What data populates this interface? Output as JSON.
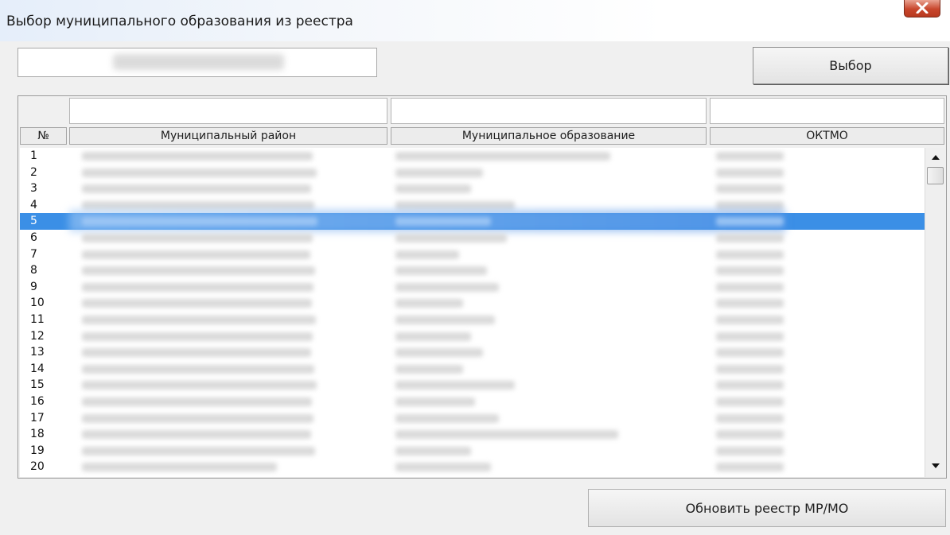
{
  "window": {
    "title": "Выбор муниципального образования из реестра",
    "close_glyph": "✕"
  },
  "search": {
    "value": "",
    "placeholder": ""
  },
  "buttons": {
    "select_label": "Выбор",
    "refresh_label": "Обновить реестр МР/МО"
  },
  "table": {
    "columns": [
      "№",
      "Муниципальный район",
      "Муниципальное образование",
      "ОКТМО"
    ],
    "selected_row": 5,
    "rows": [
      {
        "num": "1"
      },
      {
        "num": "2"
      },
      {
        "num": "3"
      },
      {
        "num": "4"
      },
      {
        "num": "5"
      },
      {
        "num": "6"
      },
      {
        "num": "7"
      },
      {
        "num": "8"
      },
      {
        "num": "9"
      },
      {
        "num": "10"
      },
      {
        "num": "11"
      },
      {
        "num": "12"
      },
      {
        "num": "13"
      },
      {
        "num": "14"
      },
      {
        "num": "15"
      },
      {
        "num": "16"
      },
      {
        "num": "17"
      },
      {
        "num": "18"
      },
      {
        "num": "19"
      },
      {
        "num": "20"
      }
    ]
  },
  "colors": {
    "selection": "#3b8fe6",
    "close_button": "#c8462c"
  },
  "icons": {
    "close": "close-icon",
    "scroll_up": "arrow-up-icon",
    "scroll_down": "arrow-down-icon"
  }
}
